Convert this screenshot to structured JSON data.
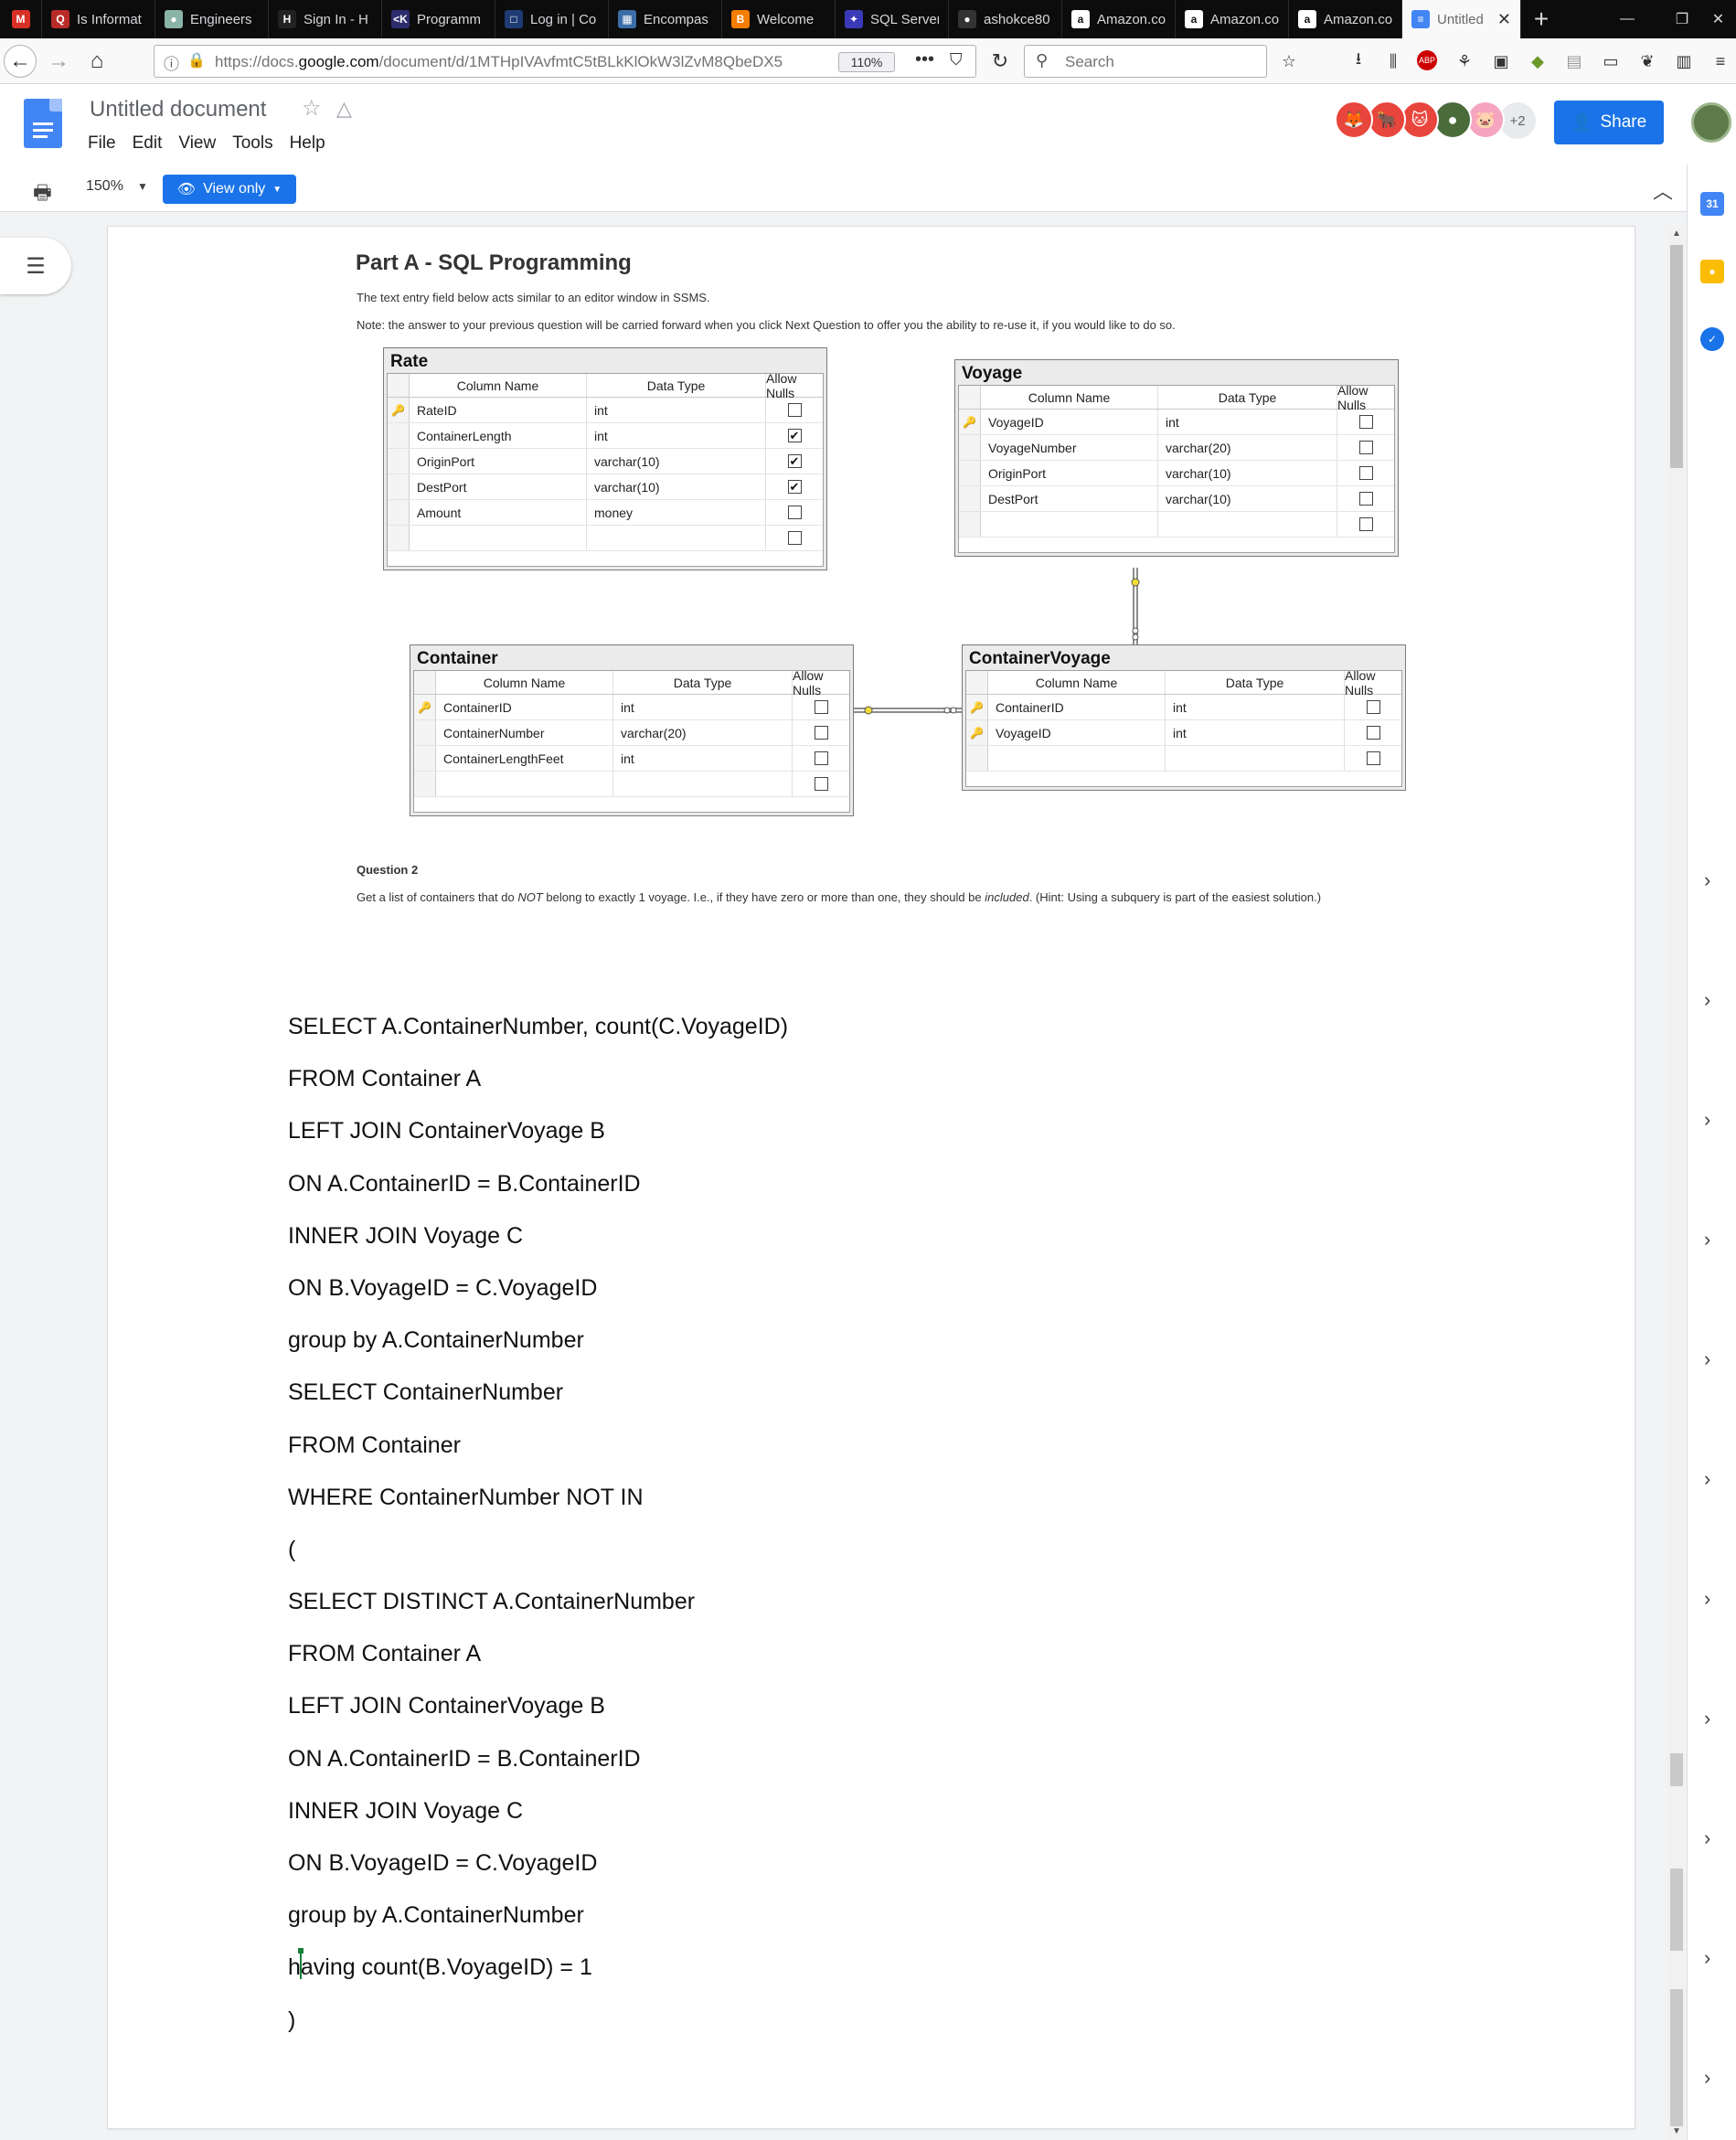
{
  "browser": {
    "tabs": [
      {
        "title": "",
        "icon": "gmail-icon",
        "color": "#d93025",
        "glyph": "M"
      },
      {
        "title": "Is Informat",
        "icon": "quora-icon",
        "color": "#b92b27",
        "glyph": "Q"
      },
      {
        "title": "Engineers",
        "icon": "engineers-icon",
        "color": "#8ab4a8",
        "glyph": "●"
      },
      {
        "title": "Sign In - H",
        "icon": "hackerrank-icon",
        "color": "#222",
        "glyph": "H"
      },
      {
        "title": "Programm",
        "icon": "codex-icon",
        "color": "#2d2d6e",
        "glyph": "<K"
      },
      {
        "title": "Log in | Co",
        "icon": "coursera-icon",
        "color": "#1f3b73",
        "glyph": "□"
      },
      {
        "title": "Encompas",
        "icon": "encompass-icon",
        "color": "#3b6ea8",
        "glyph": "▦"
      },
      {
        "title": "Welcome",
        "icon": "blogger-icon",
        "color": "#f57d00",
        "glyph": "B"
      },
      {
        "title": "SQL Server",
        "icon": "sqlserver-icon",
        "color": "#3a3ab8",
        "glyph": "✦"
      },
      {
        "title": "ashokce80",
        "icon": "github-icon",
        "color": "#333",
        "glyph": "●"
      },
      {
        "title": "Amazon.co",
        "icon": "amazon-icon",
        "color": "#ffffff",
        "glyph": "a"
      },
      {
        "title": "Amazon.co",
        "icon": "amazon-icon",
        "color": "#ffffff",
        "glyph": "a"
      },
      {
        "title": "Amazon.co",
        "icon": "amazon-icon",
        "color": "#ffffff",
        "glyph": "a"
      },
      {
        "title": "Untitled",
        "icon": "google-docs-icon",
        "color": "#4285f4",
        "glyph": "≡",
        "active": true
      }
    ],
    "url_prefix": "https://docs.",
    "url_domain": "google.com",
    "url_rest": "/document/d/1MTHpIVAvfmtC5tBLkKlOkW3lZvM8QbeDX5",
    "zoom": "110%",
    "search_placeholder": "Search"
  },
  "docs": {
    "title": "Untitled document",
    "menu": [
      "File",
      "Edit",
      "View",
      "Tools",
      "Help"
    ],
    "share_label": "Share",
    "more_collaborators": "+2",
    "collaborators": [
      {
        "color": "#e8453c",
        "glyph": "🦊"
      },
      {
        "color": "#e8453c",
        "glyph": "🐂"
      },
      {
        "color": "#e8453c",
        "glyph": "🐱"
      },
      {
        "color": "#4a6b3a",
        "glyph": "●"
      },
      {
        "color": "#f6a5c0",
        "glyph": "🐷"
      }
    ],
    "zoom": "150%",
    "mode_label": "View only",
    "accent": "#1a73e8"
  },
  "content": {
    "heading": "Part A - SQL Programming",
    "note1": "The text entry field below acts similar to an editor window in SSMS.",
    "note2": "Note: the answer to your previous question will be carried forward when you click Next Question to offer you the ability to re-use it, if you would like to do so.",
    "question_label": "Question 2",
    "question_pre": "Get a list of containers that do ",
    "question_not": "NOT",
    "question_mid": " belong to exactly 1 voyage. I.e., if they have zero or more than one, they should be ",
    "question_included": "included",
    "question_post": ". (Hint: Using a subquery is part of the easiest solution.)",
    "column_headers": {
      "name": "Column Name",
      "type": "Data Type",
      "nulls": "Allow Nulls"
    },
    "tables": [
      {
        "name": "Rate",
        "rows": [
          {
            "col": "RateID",
            "type": "int",
            "nulls": false,
            "key": true
          },
          {
            "col": "ContainerLength",
            "type": "int",
            "nulls": true,
            "key": false
          },
          {
            "col": "OriginPort",
            "type": "varchar(10)",
            "nulls": true,
            "key": false
          },
          {
            "col": "DestPort",
            "type": "varchar(10)",
            "nulls": true,
            "key": false
          },
          {
            "col": "Amount",
            "type": "money",
            "nulls": false,
            "key": false
          },
          {
            "col": "",
            "type": "",
            "nulls": false,
            "key": false
          }
        ]
      },
      {
        "name": "Voyage",
        "rows": [
          {
            "col": "VoyageID",
            "type": "int",
            "nulls": false,
            "key": true
          },
          {
            "col": "VoyageNumber",
            "type": "varchar(20)",
            "nulls": false,
            "key": false
          },
          {
            "col": "OriginPort",
            "type": "varchar(10)",
            "nulls": false,
            "key": false
          },
          {
            "col": "DestPort",
            "type": "varchar(10)",
            "nulls": false,
            "key": false
          },
          {
            "col": "",
            "type": "",
            "nulls": false,
            "key": false
          }
        ]
      },
      {
        "name": "Container",
        "rows": [
          {
            "col": "ContainerID",
            "type": "int",
            "nulls": false,
            "key": true
          },
          {
            "col": "ContainerNumber",
            "type": "varchar(20)",
            "nulls": false,
            "key": false
          },
          {
            "col": "ContainerLengthFeet",
            "type": "int",
            "nulls": false,
            "key": false
          },
          {
            "col": "",
            "type": "",
            "nulls": false,
            "key": false
          }
        ]
      },
      {
        "name": "ContainerVoyage",
        "rows": [
          {
            "col": "ContainerID",
            "type": "int",
            "nulls": false,
            "key": true
          },
          {
            "col": "VoyageID",
            "type": "int",
            "nulls": false,
            "key": true
          },
          {
            "col": "",
            "type": "",
            "nulls": false,
            "key": false
          }
        ]
      }
    ],
    "sql_lines": [
      "SELECT A.ContainerNumber, count(C.VoyageID)",
      "FROM Container A",
      "LEFT JOIN ContainerVoyage B",
      "ON A.ContainerID = B.ContainerID",
      "INNER JOIN Voyage C",
      "ON B.VoyageID = C.VoyageID",
      "group by A.ContainerNumber",
      "SELECT ContainerNumber",
      "FROM Container",
      "WHERE ContainerNumber NOT IN",
      "(",
      "SELECT DISTINCT A.ContainerNumber",
      "FROM Container A",
      "LEFT JOIN ContainerVoyage B",
      "ON A.ContainerID = B.ContainerID",
      "INNER JOIN Voyage C",
      "ON B.VoyageID = C.VoyageID",
      "group by A.ContainerNumber",
      "having count(B.VoyageID) = 1",
      ")"
    ],
    "caret_line": 18,
    "caret_after": "h",
    "caret_before": "aving count(B.VoyageID) = 1"
  },
  "side_panel": {
    "icons": [
      {
        "name": "calendar-icon",
        "color": "#4285f4",
        "glyph": "31"
      },
      {
        "name": "keep-icon",
        "color": "#fbbc04",
        "glyph": "●"
      },
      {
        "name": "tasks-icon",
        "color": "#1a73e8",
        "glyph": "✓"
      }
    ]
  }
}
